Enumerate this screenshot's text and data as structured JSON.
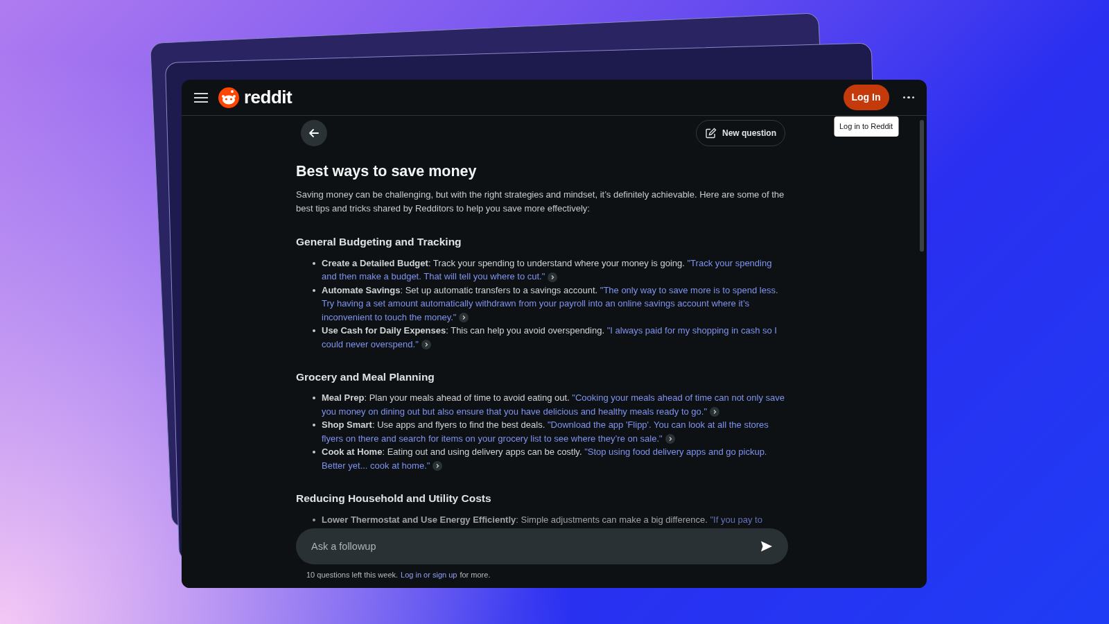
{
  "header": {
    "logo_text": "reddit",
    "login_button": "Log In",
    "tooltip": "Log in to Reddit"
  },
  "toolbar": {
    "new_question": "New question"
  },
  "article": {
    "title": "Best ways to save money",
    "intro": "Saving money can be challenging, but with the right strategies and mindset, it’s definitely achievable. Here are some of the best tips and tricks shared by Redditors to help you save more effectively:",
    "sections": [
      {
        "heading": "General Budgeting and Tracking",
        "items": [
          {
            "text": "**Create a Detailed Budget**: Track your spending to understand where your money is going.",
            "quote": "\"Track your spending and then make a budget. That will tell you where to cut.\"",
            "faded": false
          },
          {
            "text": "**Automate Savings**: Set up automatic transfers to a savings account.",
            "quote": "\"The only way to save more is to spend less. Try having a set amount automatically withdrawn from your payroll into an online savings account where it’s inconvenient to touch the money.\"",
            "faded": false
          },
          {
            "text": "**Use Cash for Daily Expenses**: This can help you avoid overspending.",
            "quote": "\"I always paid for my shopping in cash so I could never overspend.\"",
            "faded": false
          }
        ]
      },
      {
        "heading": "Grocery and Meal Planning",
        "items": [
          {
            "text": "**Meal Prep**: Plan your meals ahead of time to avoid eating out.",
            "quote": "\"Cooking your meals ahead of time can not only save you money on dining out but also ensure that you have delicious and healthy meals ready to go.\"",
            "faded": false
          },
          {
            "text": "**Shop Smart**: Use apps and flyers to find the best deals.",
            "quote": "\"Download the app 'Flipp'. You can look at all the stores flyers on there and search for items on your grocery list to see where they’re on sale.\"",
            "faded": false
          },
          {
            "text": "**Cook at Home**: Eating out and using delivery apps can be costly.",
            "quote": "\"Stop using food delivery apps and go pickup. Better yet... cook at home.\"",
            "faded": false
          }
        ]
      },
      {
        "heading": "Reducing Household and Utility Costs",
        "items": [
          {
            "text": "**Lower Thermostat and Use Energy Efficiently**: Simple adjustments can make a big difference.",
            "quote": "\"If you pay to",
            "faded": true
          }
        ]
      }
    ]
  },
  "followup": {
    "placeholder": "Ask a followup",
    "note": "10 questions left this week.",
    "note_link": "Log in or sign up",
    "note_end": "for more."
  }
}
